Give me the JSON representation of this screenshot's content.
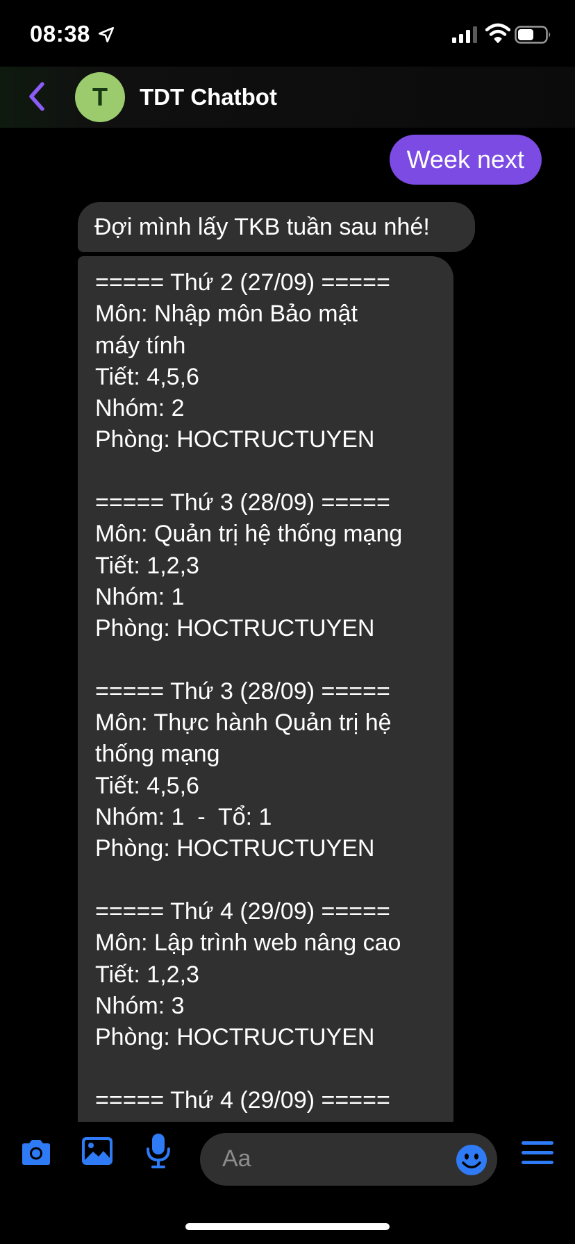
{
  "status_bar": {
    "time": "08:38",
    "icons": [
      "location-arrow-icon",
      "cellular-signal-icon",
      "wifi-icon",
      "battery-icon"
    ]
  },
  "header": {
    "avatar_letter": "T",
    "title": "TDT Chatbot",
    "accent_color": "#8b5cf6"
  },
  "messages": {
    "outgoing": "Week next",
    "incoming_intro": "Đợi mình lấy TKB tuần sau nhé!",
    "schedule_lines": [
      "===== Thứ 2 (27/09) =====",
      "Môn: Nhập môn Bảo mật",
      "máy tính",
      "Tiết: 4,5,6",
      "Nhóm: 2",
      "Phòng: HOCTRUCTUYEN",
      "",
      "===== Thứ 3 (28/09) =====",
      "Môn: Quản trị hệ thống mạng",
      "Tiết: 1,2,3",
      "Nhóm: 1",
      "Phòng: HOCTRUCTUYEN",
      "",
      "===== Thứ 3 (28/09) =====",
      "Môn: Thực hành Quản trị hệ",
      "thống mạng",
      "Tiết: 4,5,6",
      "Nhóm: 1  -  Tổ: 1",
      "Phòng: HOCTRUCTUYEN",
      "",
      "===== Thứ 4 (29/09) =====",
      "Môn: Lập trình web nâng cao",
      "Tiết: 1,2,3",
      "Nhóm: 3",
      "Phòng: HOCTRUCTUYEN",
      "",
      "===== Thứ 4 (29/09) ====="
    ],
    "outgoing_color": "#7b4be4",
    "incoming_color": "#303030"
  },
  "composer": {
    "placeholder": "Aa",
    "icons": [
      "camera-icon",
      "photo-icon",
      "microphone-icon",
      "emoji-icon",
      "menu-icon"
    ],
    "icon_color": "#2f7bf5"
  }
}
